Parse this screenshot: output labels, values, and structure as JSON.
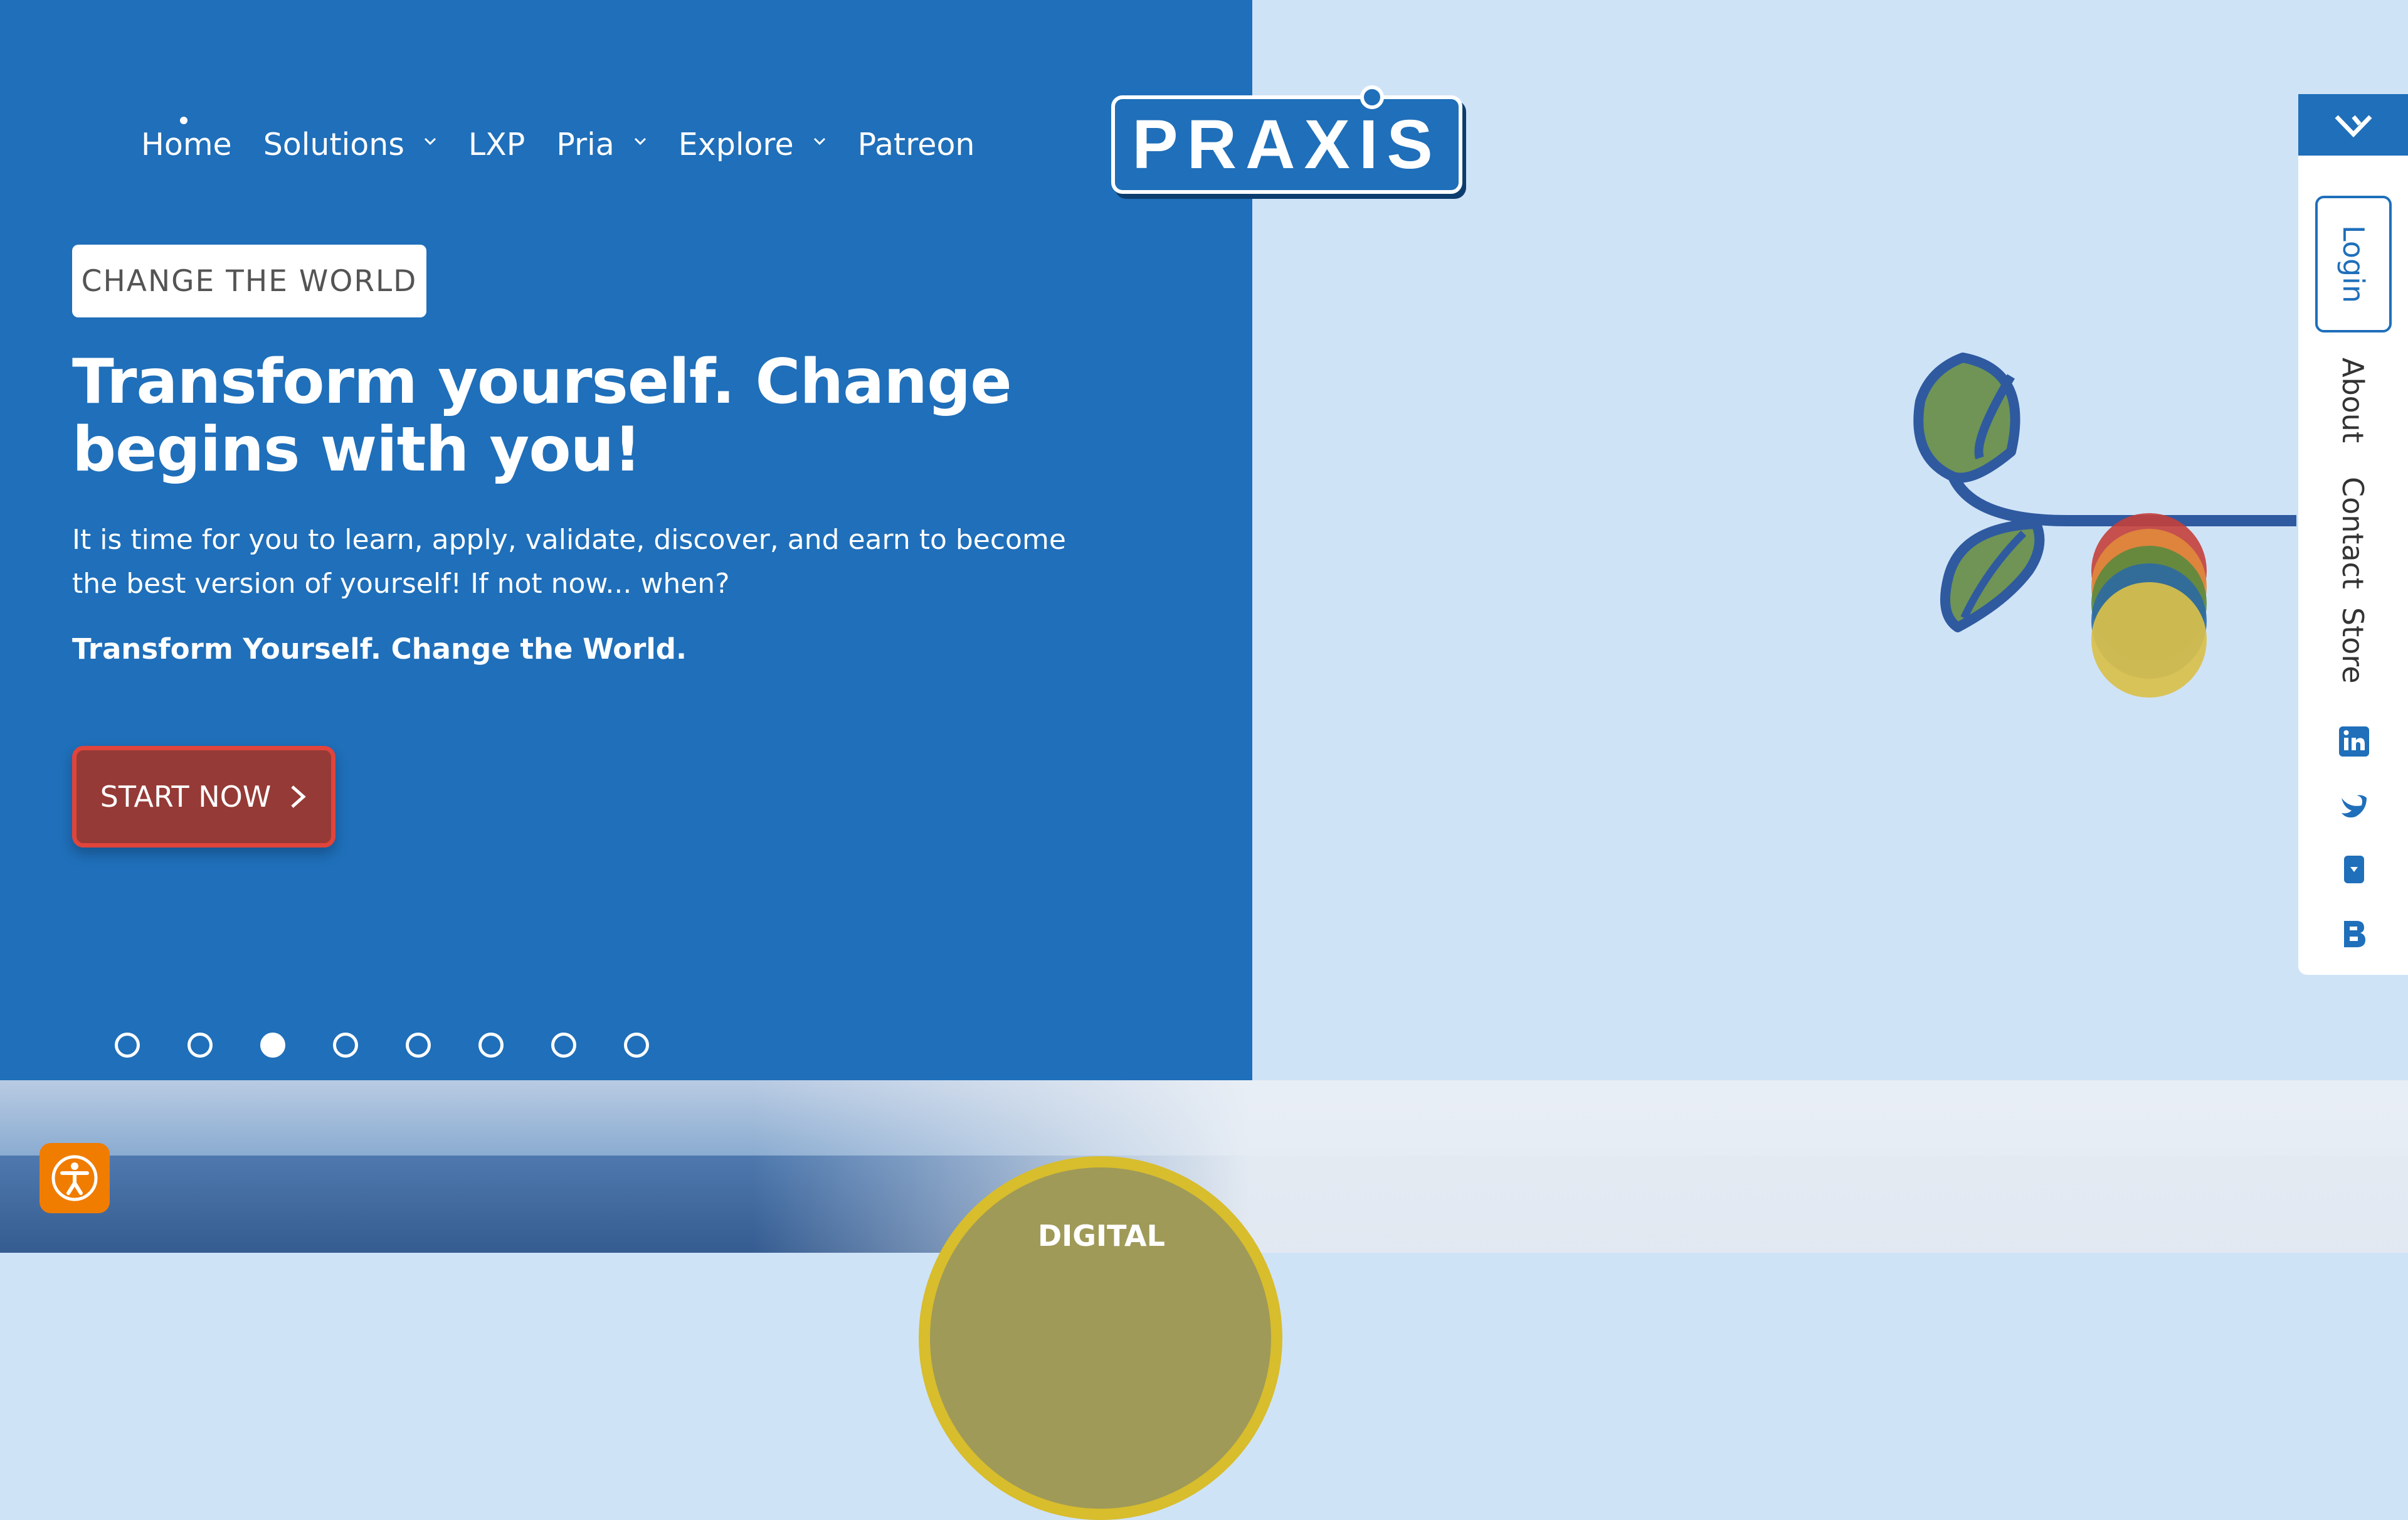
{
  "nav": {
    "items": [
      {
        "label": "Home",
        "has_dropdown": false,
        "active": true
      },
      {
        "label": "Solutions",
        "has_dropdown": true
      },
      {
        "label": "LXP",
        "has_dropdown": false
      },
      {
        "label": "Pria",
        "has_dropdown": true
      },
      {
        "label": "Explore",
        "has_dropdown": true
      },
      {
        "label": "Patreon",
        "has_dropdown": false
      }
    ]
  },
  "logo": {
    "text": "PRAXIS"
  },
  "hero": {
    "badge": "CHANGE THE WORLD",
    "headline": "Transform yourself. Change begins with you!",
    "subtext": "It is time for you to learn, apply, validate, discover, and earn to become the best version of yourself! If not now... when?",
    "tagline": "Transform Yourself. Change the World.",
    "cta_label": "START NOW",
    "cta_icon": "chevron-right-icon",
    "slides_total": 8,
    "active_slide": 3
  },
  "side_panel": {
    "login_label": "Login",
    "links": [
      "About",
      "Contact",
      "Store"
    ],
    "icons": [
      "linkedin-icon",
      "twitter-icon",
      "bookmark-icon",
      "behance-icon"
    ]
  },
  "bottom": {
    "circle_label": "DIGITAL"
  },
  "colors": {
    "primary_blue": "#1f6fba",
    "light_blue": "#cfe3f7",
    "cta_red": "#953a36",
    "accessibility_orange": "#f07c00",
    "circle_gold": "#d8bd2c"
  }
}
